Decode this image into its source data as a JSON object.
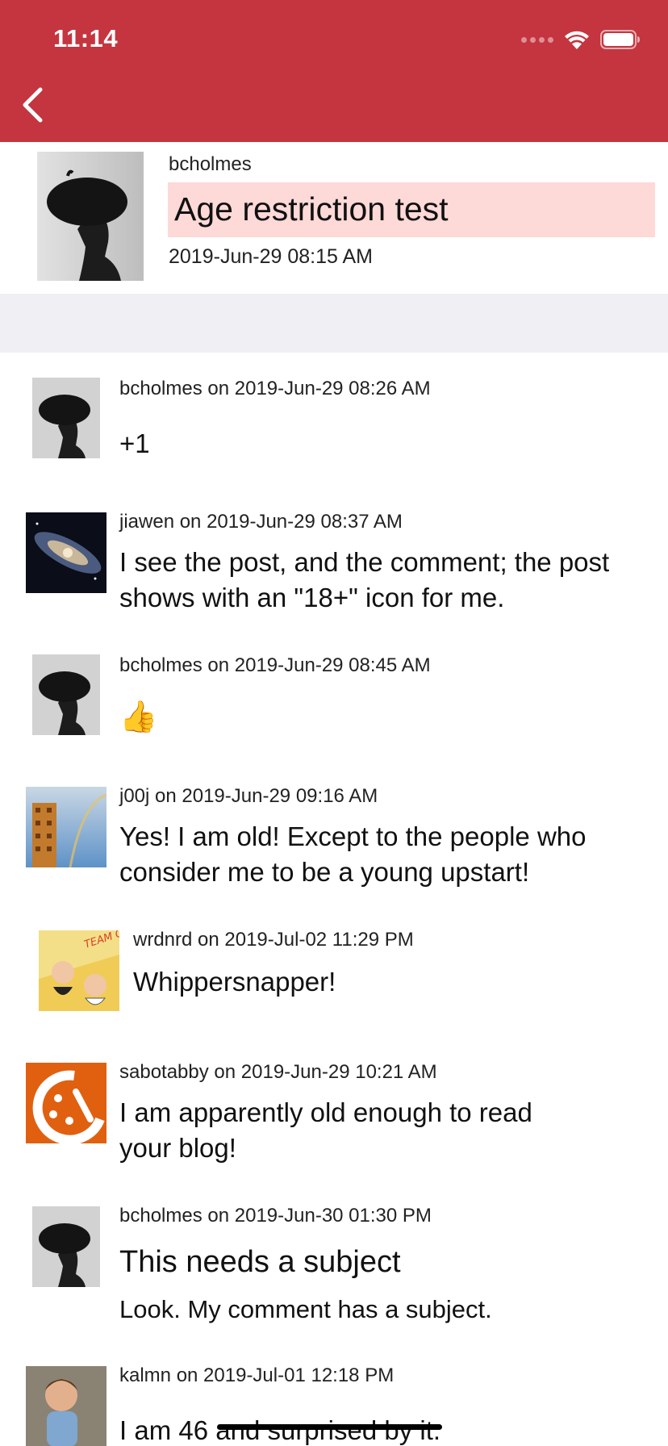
{
  "status_bar": {
    "time": "11:14"
  },
  "nav": {
    "back_icon": "chevron-left-icon"
  },
  "post": {
    "author": "bcholmes",
    "title": "Age restriction test",
    "date": "2019-Jun-29 08:15 AM"
  },
  "comments": [
    {
      "meta": "bcholmes on 2019-Jun-29 08:26 AM",
      "body": "+1",
      "avatar": "beret-avatar"
    },
    {
      "meta": "jiawen on 2019-Jun-29 08:37 AM",
      "body": "I see the post, and the comment; the post shows with an \"18+\" icon for me.",
      "avatar": "galaxy-avatar"
    },
    {
      "meta": "bcholmes on 2019-Jun-29 08:45 AM",
      "body": "👍",
      "avatar": "beret-avatar"
    },
    {
      "meta": "j00j on 2019-Jun-29 09:16 AM",
      "body": "Yes! I am old! Except to the people who consider me to be a young upstart!",
      "avatar": "rainbow-building-avatar"
    },
    {
      "meta": "wrdnrd on 2019-Jul-02 11:29 PM",
      "body": "Whippersnapper!",
      "avatar": "team-old-fw-avatar",
      "avatar_text": "TEAM OLD FW"
    },
    {
      "meta": "sabotabby on 2019-Jun-29 10:21 AM",
      "body": "I am apparently old enough to read your blog!",
      "avatar": "clock-avatar"
    },
    {
      "meta": "bcholmes on 2019-Jun-30 01:30 PM",
      "subject": "This needs a subject",
      "body": "Look. My comment has a subject.",
      "avatar": "beret-avatar"
    },
    {
      "meta": "kalmn on 2019-Jul-01 12:18 PM",
      "body_plain": "I am 46",
      "body_struck": "and surprised by it.",
      "avatar": "child-photo-avatar"
    }
  ],
  "colors": {
    "header": "#c4353f",
    "title_highlight": "#fdd9d8",
    "separator": "#efeff4"
  }
}
